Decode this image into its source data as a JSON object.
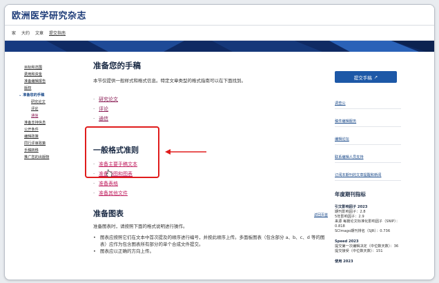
{
  "header": {
    "brand": "欧洲医学研究杂志"
  },
  "nav": {
    "home": "家",
    "about": "大约",
    "articles": "文章",
    "submission": "提交指南"
  },
  "sidebar": {
    "items": [
      {
        "label": "目标和范围"
      },
      {
        "label": "费用和资金"
      },
      {
        "label": "准备编辑报告"
      },
      {
        "label": "版权"
      }
    ],
    "group_label": "准备您的手稿",
    "group_icon": "chevron-down-icon",
    "sub_items": [
      {
        "label": "研究论文"
      },
      {
        "label": "评论"
      },
      {
        "label": "通信"
      }
    ],
    "after": [
      {
        "label": "准备支持信息"
      },
      {
        "label": "公开条件"
      },
      {
        "label": "编辑政策"
      },
      {
        "label": "同行评审政策"
      },
      {
        "label": "手稿转移"
      },
      {
        "label": "推广您的出版物"
      }
    ]
  },
  "main": {
    "title": "准备您的手稿",
    "intro": "本节仅提供一般样式和格式信息。特定文章类型的格式指南可以在下面找到。",
    "article_types": [
      "研究论文",
      "评论",
      "通信"
    ],
    "general_title": "一般格式准则",
    "general_items": [
      "准备主要手稿文本",
      "准备插图和图表",
      "准备表格",
      "准备其他文件"
    ],
    "figures_title": "准备图表",
    "back_to_top": "返回页首",
    "figures_para": "准备图表时，请按照下面的格式说明进行操作。",
    "figure_bullets": [
      "图表应按照它们在文本中首次提及的顺序进行编号，并按此顺序上传。多面板图表（包含部分 a、b、c、d 等的图表）应作为包含图表所有部分的单个合成文件提交。",
      "图表应以正确的方向上传。"
    ]
  },
  "right": {
    "submit_label": "提交手稿",
    "submit_icon": "external-link-icon",
    "links": [
      "调查公",
      "稿件编辑服务",
      "编辑论坛",
      "联系编辑人员支持",
      "订阅本期刊的文章提醒和新闻"
    ],
    "metrics_title": "年度期刊指标",
    "metrics": [
      {
        "heading": "引文影响因子 2023",
        "lines": [
          "期刊影响因子：2.8",
          "5年影响因子：2.9",
          "来源 每篇论文标准化影响因子（SNIP）：0.818",
          "SCImago期刊排名（SJR）：0.736"
        ]
      },
      {
        "heading": "Speed 2023",
        "lines": [
          "提交第一次编辑决定（中位数天数）：36",
          "提交接受（中位数天数）：151"
        ]
      },
      {
        "heading": "使用 2023",
        "lines": []
      }
    ]
  },
  "colors": {
    "highlight": "#e01b1b",
    "brand": "#1d3b78",
    "button": "#1d58a7"
  }
}
